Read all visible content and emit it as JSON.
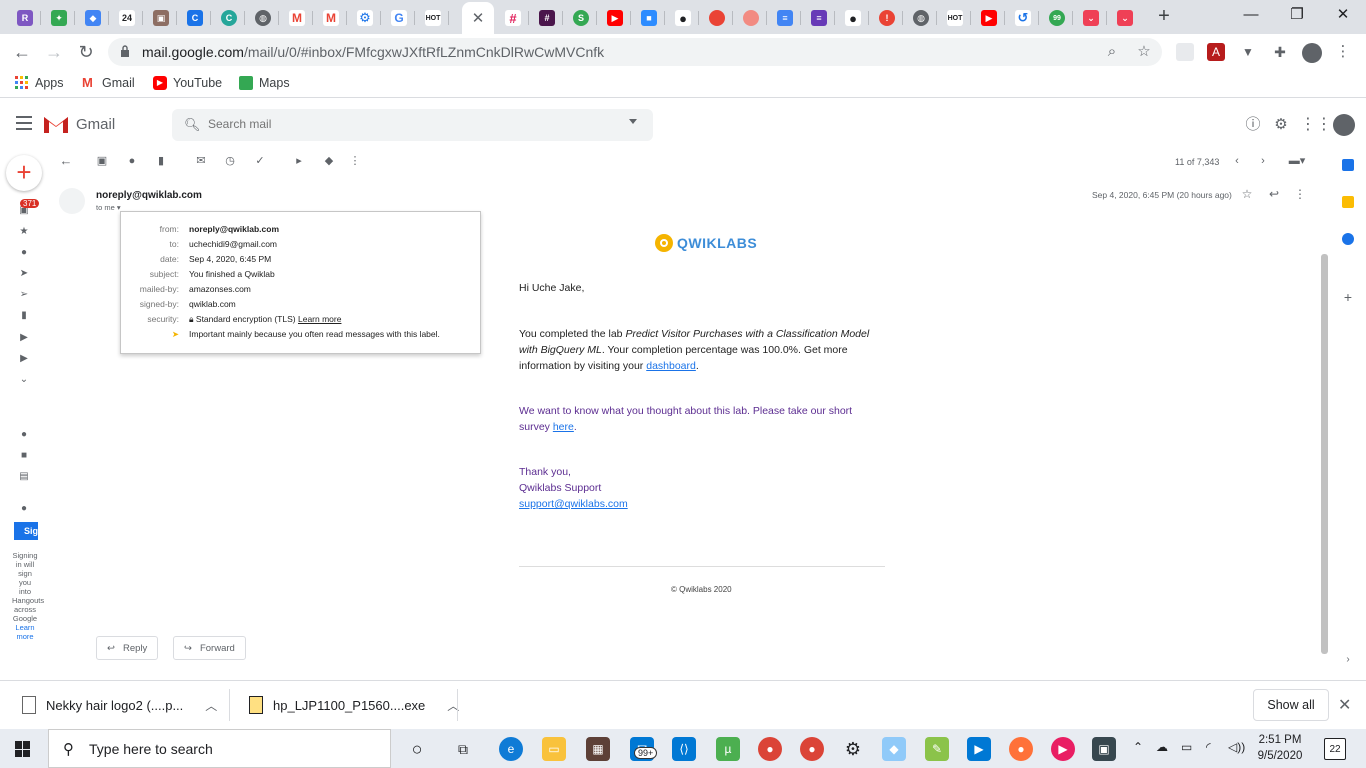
{
  "browser": {
    "url_host": "mail.google.com",
    "url_path": "/mail/u/0/#inbox/FMfcgxwJXftRfLZnmCnkDlRwCwMVCnfk",
    "tab_badge": "24",
    "bookmarks": [
      "Apps",
      "Gmail",
      "YouTube",
      "Maps"
    ]
  },
  "gmail": {
    "brand": "Gmail",
    "search_placeholder": "Search mail",
    "unread_badge": "371",
    "pager": "11 of 7,343",
    "hangouts_signin": "Sig",
    "hangouts_text": "Signing in will sign you into Hangouts across Google",
    "hangouts_link": "Learn more"
  },
  "message": {
    "sender": "noreply@qwiklab.com",
    "to_me": "to me",
    "date": "Sep 4, 2020, 6:45 PM (20 hours ago)",
    "details": {
      "from_label": "from:",
      "from": "noreply@qwiklab.com",
      "to_label": "to:",
      "to": "uchechidi9@gmail.com",
      "date_label": "date:",
      "date": "Sep 4, 2020, 6:45 PM",
      "subject_label": "subject:",
      "subject": "You finished a Qwiklab",
      "mailedby_label": "mailed-by:",
      "mailedby": "amazonses.com",
      "signedby_label": "signed-by:",
      "signedby": "qwiklab.com",
      "security_label": "security:",
      "security": "Standard encryption (TLS)",
      "security_link": "Learn more",
      "importance": "Important mainly because you often read messages with this label."
    },
    "body": {
      "logo": "QWIKLABS",
      "greeting": "Hi Uche Jake,",
      "p1_a": "You completed the lab ",
      "p1_lab": "Predict Visitor Purchases with a Classification Model with BigQuery ML",
      "p1_b": ". Your completion percentage was 100.0%. Get more information by visiting your ",
      "p1_link": "dashboard",
      "p1_end": ".",
      "p2_a": "We want to know what you thought about this lab. Please take our short survey ",
      "p2_link": "here",
      "p2_end": ".",
      "thanks": "Thank you,",
      "team": "Qwiklabs Support",
      "support_email": "support@qwiklabs.com",
      "copyright": "© Qwiklabs 2020"
    },
    "reply_label": "Reply",
    "forward_label": "Forward"
  },
  "downloads": {
    "items": [
      "Nekky hair logo2 (....p...",
      "hp_LJP1100_P1560....exe"
    ],
    "show_all": "Show all"
  },
  "taskbar": {
    "search_placeholder": "Type here to search",
    "mail_badge": "99+",
    "time": "2:51 PM",
    "date": "9/5/2020",
    "notifications": "22"
  },
  "colors": {
    "link": "#1a73e8",
    "purple_text": "#5c2d91",
    "qwiklabs_blue": "#3d8dd8",
    "qwiklabs_yellow": "#f5b400"
  }
}
